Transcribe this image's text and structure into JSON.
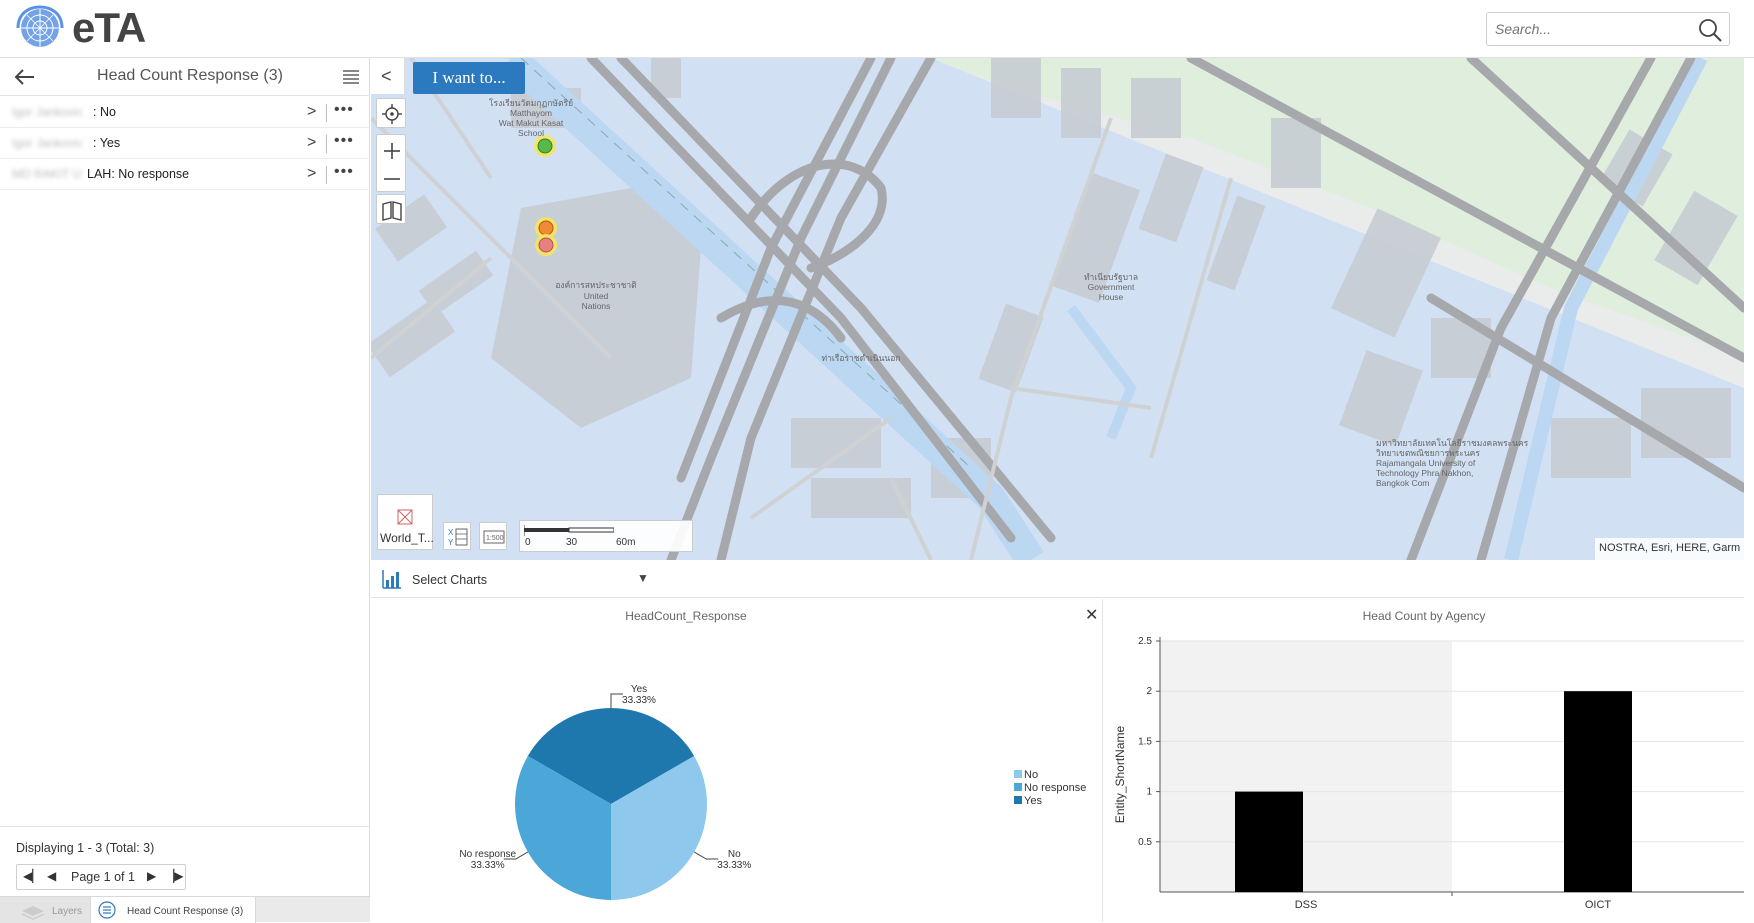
{
  "header": {
    "app_title": "eTA",
    "search_placeholder": "Search..."
  },
  "left_panel": {
    "title": "Head Count Response (3)",
    "results": [
      {
        "name_blurred": "Igor Jankovic",
        "suffix": ": No"
      },
      {
        "name_blurred": "Igor Jankovic",
        "suffix": ": Yes"
      },
      {
        "name_blurred": "MD RAKIT U",
        "suffix": "LAH: No response"
      }
    ],
    "paging": {
      "display_text": "Displaying 1 - 3 (Total: 3)",
      "page_text": "Page 1 of 1"
    },
    "tabs": {
      "layers": "Layers",
      "results": "Head Count Response (3)"
    }
  },
  "map": {
    "iwantto_label": "I want to...",
    "basemap_label": "World_T...",
    "scale_labels": [
      "0",
      "30",
      "60m"
    ],
    "attribution": "NOSTRA, Esri, HERE, Garm",
    "place_labels": {
      "school": "โรงเรียนวัดมกุฏกษัตริย์\nMatthayom\nWat Makut Kasat\nSchool",
      "un_thai": "องค์การสหประชาชาติ",
      "un_en": "United\nNations",
      "government_house": "ทำเนียบรัฐบาล\nGovernment\nHouse",
      "rajamangala": "มหาวิทยาลัยเทคโนโลยีราชมงคลพระนคร\nวิทยาเขตพณิชยการพระนคร\nRajamangala University of\nTechnology Phra Nakhon,\nBangkok Com",
      "temple": "ท่าเรือราชดำเนินนอก"
    },
    "markers": [
      "green",
      "orange",
      "salmon"
    ]
  },
  "charts_bar": {
    "select_label": "Select Charts"
  },
  "chart_data": [
    {
      "type": "pie",
      "title": "HeadCount_Response",
      "slices": [
        {
          "label": "Yes",
          "value": 33.33,
          "label_text": "33.33%",
          "color": "#1f78ad"
        },
        {
          "label": "No",
          "value": 33.33,
          "label_text": "33.33%",
          "color": "#8ec8ec"
        },
        {
          "label": "No response",
          "value": 33.33,
          "label_text": "33.33%",
          "color": "#4ba7d8"
        }
      ],
      "legend": [
        "No",
        "No response",
        "Yes"
      ],
      "legend_colors": [
        "#8ec8ec",
        "#4ba7d8",
        "#1f78ad"
      ],
      "legend_position": "right"
    },
    {
      "type": "bar",
      "title": "Head Count by Agency",
      "categories": [
        "DSS",
        "OICT"
      ],
      "values": [
        1,
        2
      ],
      "ylabel": "Entity_ShortName",
      "ylim": [
        0,
        2.5
      ],
      "yticks": [
        "0.5",
        "1",
        "1.5",
        "2",
        "2.5"
      ],
      "bar_color": "#000000"
    }
  ]
}
